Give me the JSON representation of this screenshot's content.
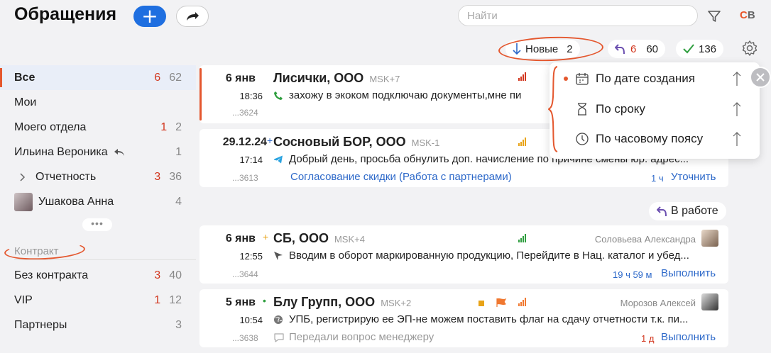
{
  "header": {
    "title": "Обращения",
    "add_label": "+",
    "search_placeholder": "Найти",
    "user_initials_c": "С",
    "user_initials_b": "В"
  },
  "statusbar": {
    "new_label": "Новые",
    "new_count": "2",
    "returned_red": "6",
    "returned_count": "60",
    "done_count": "136"
  },
  "sidebar": {
    "items": [
      {
        "label": "Все",
        "red": "6",
        "count": "62"
      },
      {
        "label": "Мои",
        "red": "",
        "count": ""
      },
      {
        "label": "Моего отдела",
        "red": "1",
        "count": "2"
      },
      {
        "label": "Ильина Вероника",
        "red": "",
        "count": "1"
      },
      {
        "label": "Отчетность",
        "red": "3",
        "count": "36"
      },
      {
        "label": "Ушакова Анна",
        "red": "",
        "count": "4"
      }
    ],
    "more": "•••",
    "section_title": "Контракт",
    "contract_items": [
      {
        "label": "Без контракта",
        "red": "3",
        "count": "40"
      },
      {
        "label": "VIP",
        "red": "1",
        "count": "12"
      },
      {
        "label": "Партнеры",
        "red": "",
        "count": "3"
      }
    ]
  },
  "cards": [
    {
      "date": "6 янв",
      "company": "Лисички, ООО",
      "tz": "MSK+7",
      "time": "18:36",
      "message": "захожу в экоком подключаю документы,мне пи",
      "number": "...3624"
    },
    {
      "date": "29.12.24",
      "mark": "+",
      "company": "Сосновый БОР, ООО",
      "tz": "MSK-1",
      "time": "17:14",
      "message": "Добрый день, просьба обнулить доп. начисление по причине смены юр. адрес...",
      "number": "...3613",
      "subject": "Согласование скидки (Работа с партнерами)",
      "due": "1 ч",
      "action": "Уточнить"
    },
    {
      "date": "6 янв",
      "mark": "+",
      "company": "СБ, ООО",
      "tz": "MSK+4",
      "time": "12:55",
      "assignee": "Соловьева Александра",
      "message": "Вводим в оборот маркированную продукцию, Перейдите в Нац. каталог и убед...",
      "number": "...3644",
      "due": "19 ч 59 м",
      "action": "Выполнить"
    },
    {
      "date": "5 янв",
      "mark": "•",
      "company": "Блу Групп, ООО",
      "tz": "MSK+2",
      "time": "10:54",
      "assignee": "Морозов Алексей",
      "message": "УПБ, регистрирую ее ЭП-не можем поставить флаг на сдачу отчетности т.к. пи...",
      "number": "...3638",
      "note": "Передали вопрос менеджеру",
      "due": "1 д",
      "action": "Выполнить"
    }
  ],
  "in_work_label": "В работе",
  "sort_menu": {
    "items": [
      {
        "label": "По дате создания",
        "icon": "calendar-icon",
        "selected": true
      },
      {
        "label": "По сроку",
        "icon": "hourglass-icon",
        "selected": false
      },
      {
        "label": "По часовому поясу",
        "icon": "clock-icon",
        "selected": false
      }
    ]
  },
  "colors": {
    "accent": "#1f6fe0",
    "annotation": "#e4572e",
    "link": "#2c68c9",
    "danger": "#d2361e",
    "success": "#2e9e3e"
  }
}
